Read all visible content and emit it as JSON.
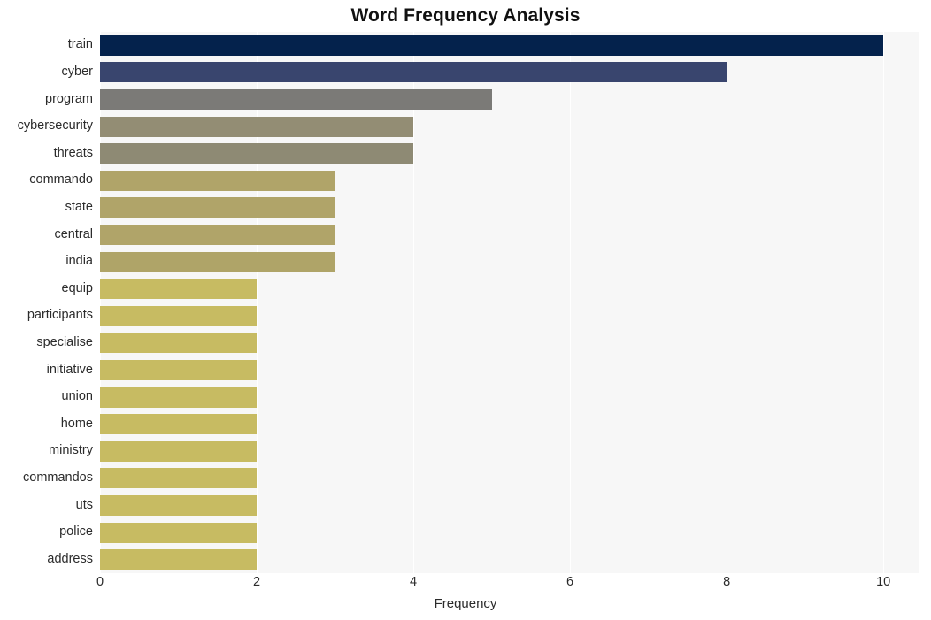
{
  "chart_data": {
    "type": "bar",
    "orientation": "horizontal",
    "title": "Word Frequency Analysis",
    "xlabel": "Frequency",
    "ylabel": "",
    "categories": [
      "train",
      "cyber",
      "program",
      "cybersecurity",
      "threats",
      "commando",
      "state",
      "central",
      "india",
      "equip",
      "participants",
      "specialise",
      "initiative",
      "union",
      "home",
      "ministry",
      "commandos",
      "uts",
      "police",
      "address"
    ],
    "values": [
      10,
      8,
      5,
      4,
      4,
      3,
      3,
      3,
      3,
      2,
      2,
      2,
      2,
      2,
      2,
      2,
      2,
      2,
      2,
      2
    ],
    "bar_colors": [
      "#04224c",
      "#39456e",
      "#7b7a77",
      "#938d74",
      "#8e8a74",
      "#b0a469",
      "#b0a469",
      "#b0a469",
      "#afa468",
      "#c7bb62",
      "#c7bb62",
      "#c7bb62",
      "#c7bb62",
      "#c7bb62",
      "#c7bb62",
      "#c7bb62",
      "#c7bb62",
      "#c7bb62",
      "#c7bb62",
      "#c7bb62"
    ],
    "xticks": [
      0,
      2,
      4,
      6,
      8,
      10
    ],
    "xtick_labels": [
      "0",
      "2",
      "4",
      "6",
      "8",
      "10"
    ],
    "xlim": [
      0,
      10.45
    ],
    "grid": true,
    "grid_axis": "x",
    "grid_color": "#ffffff",
    "plot_background": "#f7f7f7",
    "figure_background": "#ffffff",
    "legend": null,
    "title_color": "#111111",
    "tick_label_color": "#2b2b2b"
  }
}
